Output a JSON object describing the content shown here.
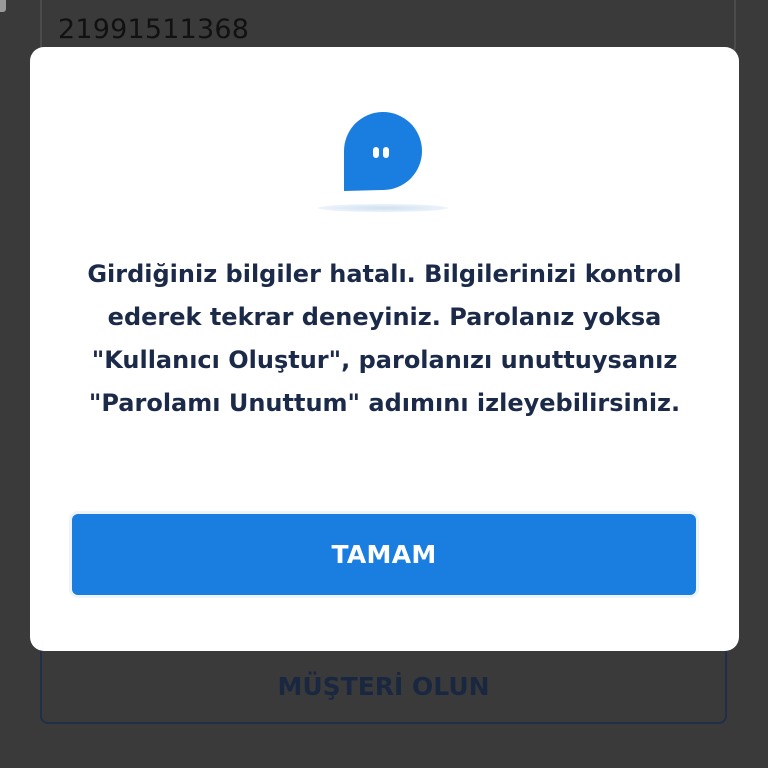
{
  "background": {
    "phone_field_value": "21991511368",
    "secondary_button_label": "MÜŞTERİ OLUN"
  },
  "dialog": {
    "icon": "chat-bubble-icon",
    "message": "Girdiğiniz bilgiler hatalı. Bilgilerinizi kontrol ederek tekrar deneyiniz. Parolanız yoksa \"Kullanıcı Oluştur\", parolanızı unuttuysanız \"Parolamı Unuttum\" adımını izleyebilirsiniz.",
    "confirm_label": "TAMAM"
  },
  "colors": {
    "accent": "#1a7ee0",
    "text_dark": "#1b2a48",
    "overlay": "#3a3a3a"
  }
}
